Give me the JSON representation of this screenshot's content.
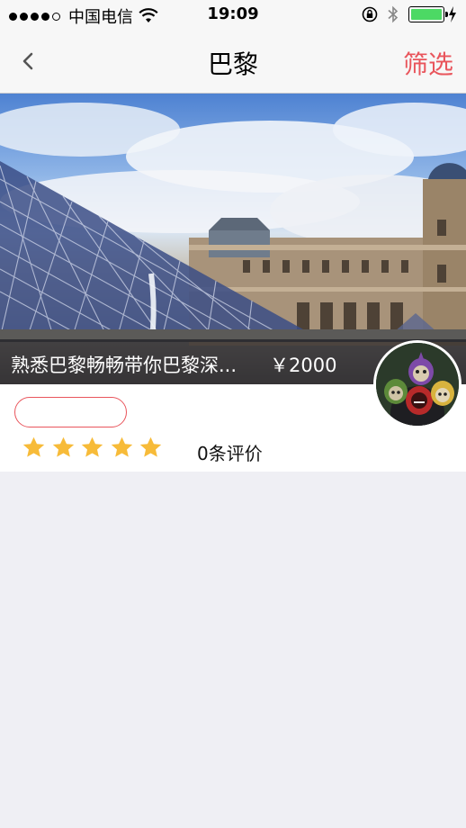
{
  "status_bar": {
    "carrier": "中国电信",
    "time": "19:09",
    "signal_bars_filled": 4,
    "signal_bars_total": 5,
    "battery_color": "#4cd964"
  },
  "nav": {
    "title": "巴黎",
    "filter_label": "筛选",
    "accent_color": "#e9555c"
  },
  "listing": {
    "title": "熟悉巴黎畅畅带你巴黎深...",
    "price": "￥2000",
    "tag": "",
    "rating_stars": 5,
    "reviews": "0条评价",
    "star_color": "#f7bb39"
  },
  "icons": {
    "back": "chevron-left-icon",
    "wifi": "wifi-icon",
    "orientation_lock": "rotation-lock-icon",
    "bluetooth": "bluetooth-icon",
    "battery": "battery-icon",
    "charging": "charging-bolt-icon",
    "star": "star-icon"
  }
}
